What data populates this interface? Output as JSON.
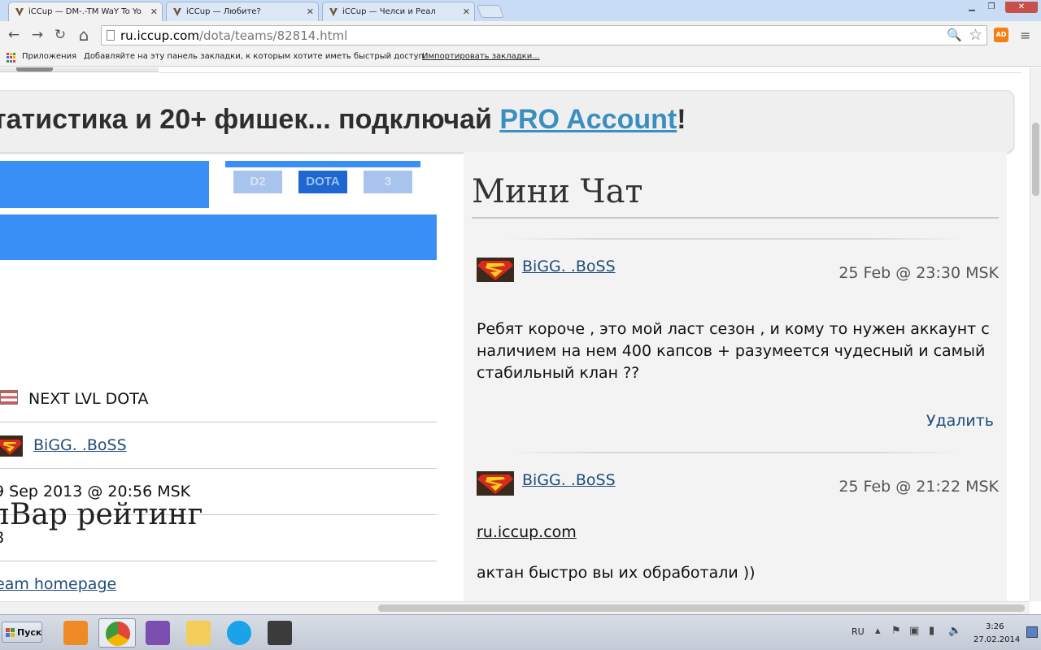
{
  "tabs": [
    {
      "title": "iCCup — DM-.-TM WaY To Yo",
      "active": true
    },
    {
      "title": "iCCup — Любите?",
      "active": false
    },
    {
      "title": "iCCup — Челси и Реал",
      "active": false
    }
  ],
  "window_controls": {
    "minimize": "▁",
    "maximize": "❐",
    "close": "✕"
  },
  "toolbar": {
    "back": "←",
    "forward": "→",
    "reload": "↻",
    "home": "⌂",
    "url_domain": "ru.iccup.com",
    "url_path": "/dota/teams/82814.html",
    "zoom_icon": "🔍",
    "star_icon": "☆",
    "extension_label": "AD",
    "menu_icon": "≡"
  },
  "bookmarks": {
    "apps_label": "Приложения",
    "hint": "Добавляйте на эту панель закладки, к которым хотите иметь быстрый доступ.",
    "import_link": "Импортировать закладки..."
  },
  "page": {
    "banner_text": "татистика и 20+ фишек... подключай ",
    "banner_link": "PRO Account",
    "banner_end": "!",
    "game_icons": [
      "D2",
      "DOTA",
      "3"
    ],
    "team_name": "NEXT LVL DOTA",
    "leader": "BiGG.  .BoSS",
    "created": "9 Sep 2013 @ 20:56 MSK",
    "count": "8",
    "homepage_link": "eam homepage",
    "rating_heading": "пВар рейтинг"
  },
  "chat": {
    "title": "Мини Чат",
    "messages": [
      {
        "user": "BiGG.  .BoSS",
        "time": "25 Feb @ 23:30 MSK",
        "text": "Ребят короче , это мой ласт сезон , и кому то нужен аккаунт с наличием на нем 400 капсов + разумеется чудесный и самый стабильный клан ??",
        "delete": "Удалить"
      },
      {
        "user": "BiGG.  .BoSS",
        "time": "25 Feb @ 21:22 MSK",
        "link": "ru.iccup.com",
        "text": "актан быстро вы их обработали ))"
      }
    ]
  },
  "taskbar": {
    "start_label": "Пуск",
    "lang": "RU",
    "time": "3:26",
    "date": "27.02.2014"
  },
  "colors": {
    "accent_blue": "#3a8ff6",
    "link": "#1f4c7a",
    "pro_link": "#3a8fc0"
  }
}
